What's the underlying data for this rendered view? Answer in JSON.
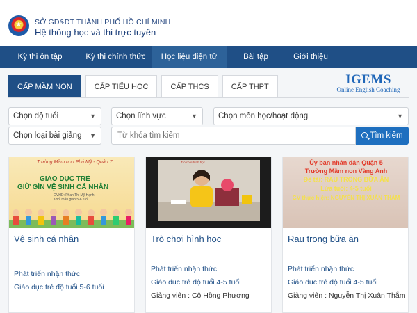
{
  "header": {
    "org": "SỞ GD&ĐT THÀNH PHỐ HỒ CHÍ MINH",
    "title": "Hệ thống học và thi trực tuyến"
  },
  "nav": {
    "items": [
      "Kỳ thi ôn tập",
      "Kỳ thi chính thức",
      "Học liệu điện tử",
      "Bài tập",
      "Giới thiệu"
    ],
    "active": "Học liệu điện tử"
  },
  "tabs": {
    "items": [
      "CẤP MẦM NON",
      "CẤP TIỂU HỌC",
      "CẤP THCS",
      "CẤP THPT"
    ],
    "active": "CẤP MẦM NON"
  },
  "brand": {
    "name": "IGEMS",
    "tagline": "Online English Coaching"
  },
  "filters": {
    "age": "Chọn độ tuổi",
    "field": "Chọn lĩnh vực",
    "subject": "Chọn môn học/hoạt động",
    "lesson_type": "Chọn loại bài giảng",
    "keyword_placeholder": "Từ khóa tìm kiếm",
    "search_label": "Tìm kiếm"
  },
  "cards": [
    {
      "title": "Vệ sinh cá nhân",
      "field": "Phát triển nhận thức |",
      "age": "Giáo dục trẻ độ tuổi 5-6 tuổi",
      "teacher": "",
      "thumb": {
        "school": "Trường Mầm non Phú Mỹ - Quận 7",
        "line1": "GIÁO DỤC TRẺ",
        "line2": "GIỮ GÌN VỆ SINH CÁ NHÂN",
        "small": "GVHD: Phan Thị Mỹ Hạnh",
        "small2": "Khối mẫu giáo 5-6 tuổi"
      }
    },
    {
      "title": "Trò chơi hình học",
      "field": "Phát triển nhận thức |",
      "age": "Giáo dục trẻ độ tuổi 4-5 tuổi",
      "teacher": "Giảng viên : Cô Hồng Phương",
      "thumb": {
        "label": "Trò chơi hình học"
      }
    },
    {
      "title": "Rau trong bữa ăn",
      "field": "Phát triển nhận thức |",
      "age": "Giáo dục trẻ độ tuổi 4-5 tuổi",
      "teacher": "Giảng viên : Nguyễn Thị Xuân Thắm",
      "thumb": {
        "l1": "Ủy ban nhân dân Quận 5",
        "l2": "Trường Mầm non Vàng Anh",
        "l3": "Đề tài: RAU TRONG BỮA ĂN",
        "l4": "Lứa tuổi: 4-5 tuổi",
        "l5": "GV thực hiện: NGUYỄN THỊ XUÂN THẮM"
      }
    }
  ]
}
